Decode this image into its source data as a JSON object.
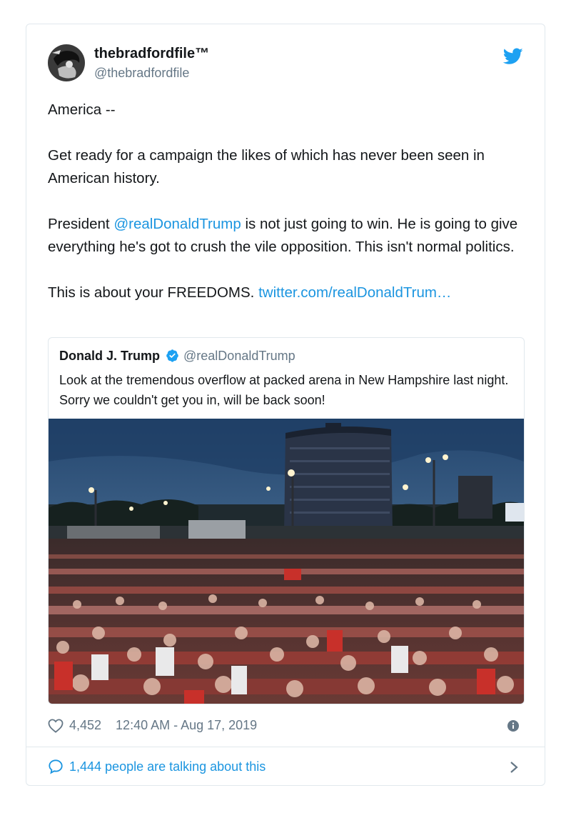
{
  "author": {
    "display_name": "thebradfordfile™",
    "handle": "@thebradfordfile"
  },
  "tweet": {
    "p1": "America --",
    "p2": "Get ready for a campaign the likes of which has never been seen in American history.",
    "p3_pre": "President ",
    "p3_mention": "@realDonaldTrump",
    "p3_post": " is not just going to win. He is going to give everything he's got to crush the vile opposition. This isn't normal politics.",
    "p4_pre": "This is about your FREEDOMS. ",
    "p4_link": "twitter.com/realDonaldTrum…"
  },
  "quoted": {
    "name": "Donald J. Trump",
    "handle": "@realDonaldTrump",
    "text": "Look at the tremendous overflow at packed arena in New Hampshire last night. Sorry we couldn't get you in, will be back soon!"
  },
  "footer": {
    "likes": "4,452",
    "timestamp": "12:40 AM - Aug 17, 2019",
    "talking": "1,444 people are talking about this"
  },
  "colors": {
    "link": "#1b95e0",
    "muted": "#657786",
    "border": "#e1e8ed"
  },
  "icons": [
    "twitter-bird-icon",
    "verified-badge-icon",
    "heart-icon",
    "info-icon",
    "comment-bubble-icon",
    "chevron-right-icon"
  ]
}
